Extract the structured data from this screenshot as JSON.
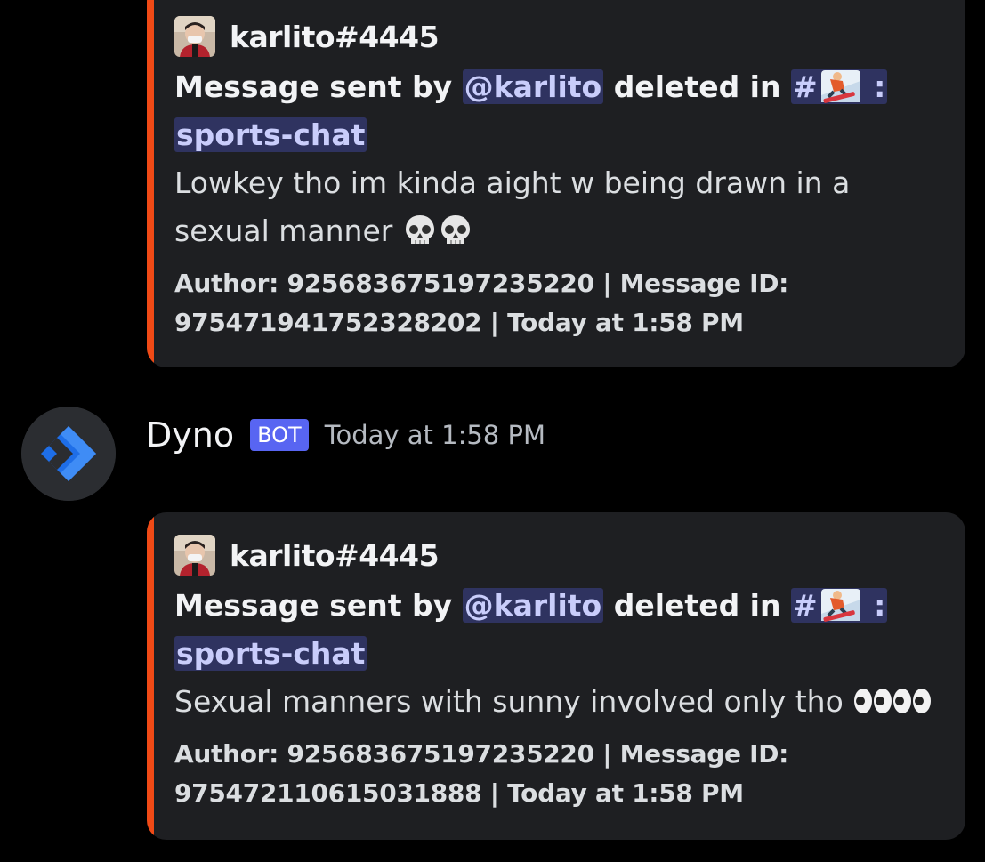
{
  "embeds": [
    {
      "author_name": "karlito#4445",
      "desc_prefix": "Message sent by ",
      "mention": "@karlito",
      "desc_mid": " deleted in ",
      "channel_hash": "#",
      "channel_colon": " :",
      "channel_name": "sports-chat",
      "message_line1": "Lowkey tho im kinda aight w being drawn in a",
      "message_line2": "sexual manner ",
      "message_emoji": "skull-icon x2",
      "footer_line1": "Author: 925683675197235220 | Message ID:",
      "footer_line2": "975471941752328202 | Today at 1:58 PM"
    },
    {
      "author_name": "karlito#4445",
      "desc_prefix": "Message sent by ",
      "mention": "@karlito",
      "desc_mid": " deleted in ",
      "channel_hash": "#",
      "channel_colon": " :",
      "channel_name": "sports-chat",
      "message_line1": "Sexual manners with sunny involved only tho ",
      "message_emoji": "eyes-icon x2",
      "footer_line1": "Author: 925683675197235220 | Message ID:",
      "footer_line2": "975472110615031888 | Today at 1:58 PM"
    }
  ],
  "bot_message": {
    "name": "Dyno",
    "tag": "BOT",
    "timestamp": "Today at 1:58 PM",
    "avatar_icon": "dyno-diamond-icon"
  },
  "colors": {
    "embed_bar": "#f04a16",
    "bot_tag": "#5865f2",
    "mention_bg": "#3c4270"
  }
}
